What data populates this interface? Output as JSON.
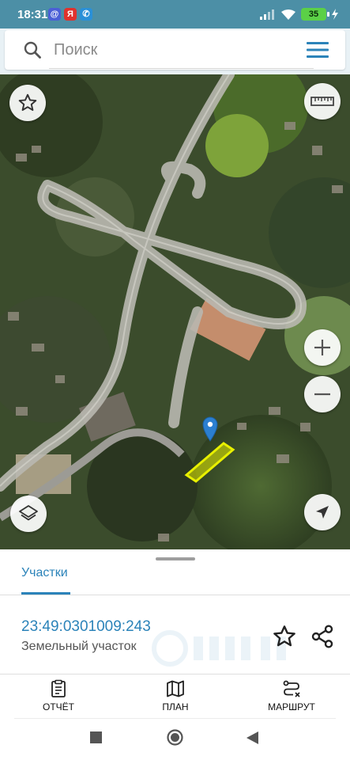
{
  "status_bar": {
    "time": "18:31",
    "notifications": [
      "@",
      "Я",
      "✆"
    ],
    "battery": "35",
    "battery_color": "#5bd047"
  },
  "search": {
    "placeholder": "Поиск",
    "value": "",
    "icon": "search-icon",
    "menu_icon": "menu-icon"
  },
  "map": {
    "type": "satellite",
    "controls": [
      "star-icon",
      "ruler-icon",
      "plus-icon",
      "minus-icon",
      "layers-icon",
      "navigation-arrow-icon"
    ],
    "highlight_color": "#e8f000",
    "marker_color": "#2b7fd0"
  },
  "sheet": {
    "tabs": [
      {
        "label": "Участки",
        "active": true
      }
    ],
    "parcel": {
      "cadastral_number": "23:49:0301009:243",
      "type": "Земельный участок"
    },
    "actions": [
      {
        "label": "ОТЧЁТ",
        "icon": "report-icon"
      },
      {
        "label": "ПЛАН",
        "icon": "map-icon"
      },
      {
        "label": "МАРШРУТ",
        "icon": "route-icon"
      }
    ]
  },
  "colors": {
    "accent": "#2b83b9",
    "status_bar": "#4c8fa6"
  }
}
